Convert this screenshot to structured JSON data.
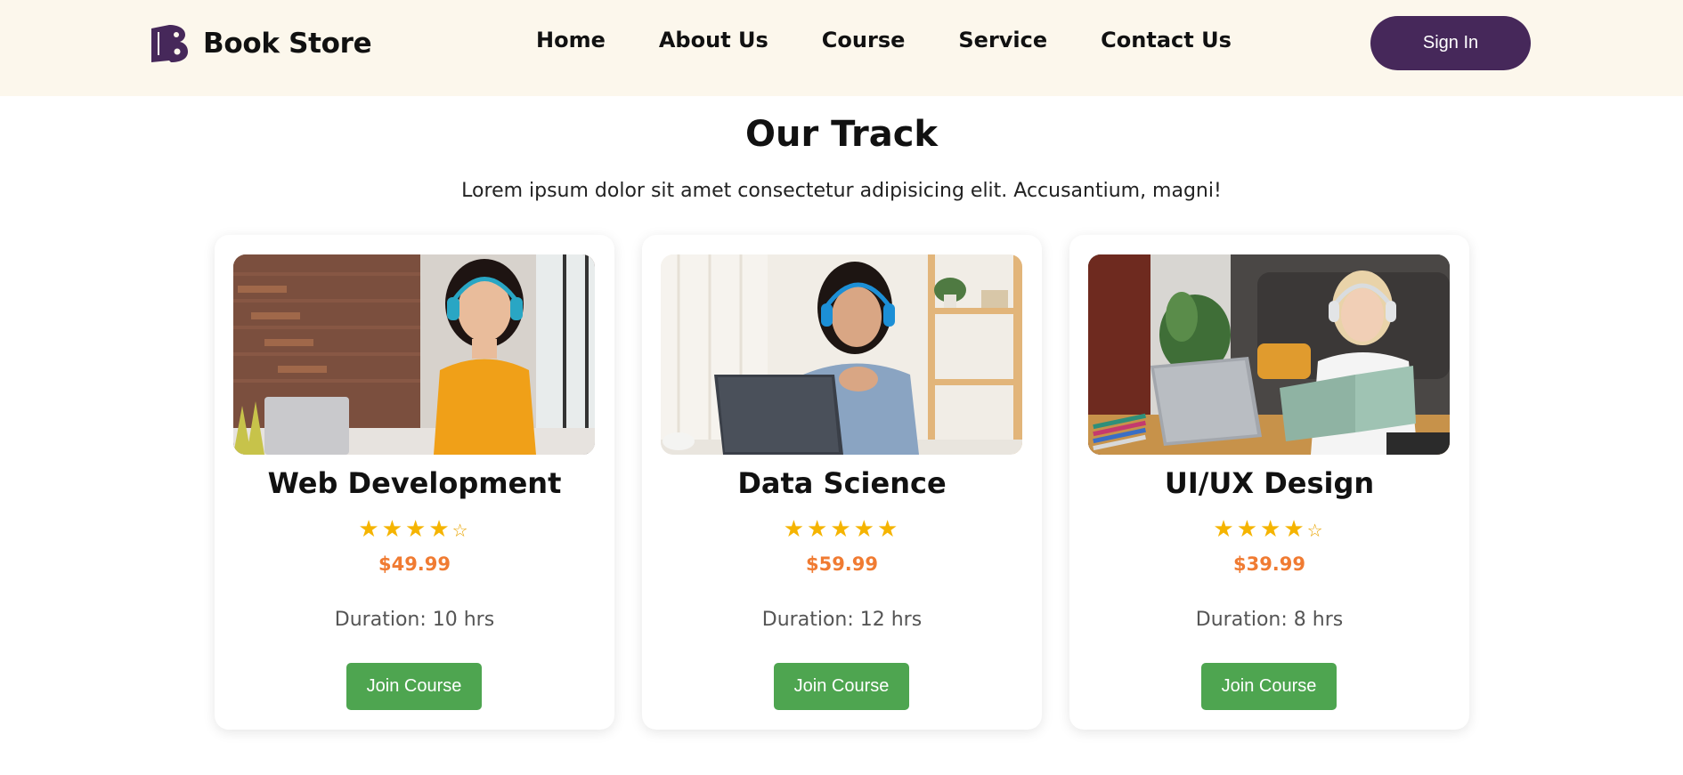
{
  "header": {
    "brand": "Book Store",
    "nav": [
      "Home",
      "About Us",
      "Course",
      "Service",
      "Contact Us"
    ],
    "sign_in": "Sign In"
  },
  "section": {
    "title": "Our Track",
    "subtitle": "Lorem ipsum dolor sit amet consectetur adipisicing elit. Accusantium, magni!"
  },
  "courses": [
    {
      "title": "Web Development",
      "rating": 4,
      "max_rating": 5,
      "price": "$49.99",
      "duration": "Duration: 10 hrs",
      "button": "Join Course"
    },
    {
      "title": "Data Science",
      "rating": 5,
      "max_rating": 5,
      "price": "$59.99",
      "duration": "Duration: 12 hrs",
      "button": "Join Course"
    },
    {
      "title": "UI/UX Design",
      "rating": 4,
      "max_rating": 5,
      "price": "$39.99",
      "duration": "Duration: 8 hrs",
      "button": "Join Course"
    }
  ],
  "colors": {
    "header_bg": "#fcf7ec",
    "brand_purple": "#46285a",
    "price_orange": "#f07b32",
    "star_gold": "#f5b400",
    "join_green": "#4ea550"
  }
}
